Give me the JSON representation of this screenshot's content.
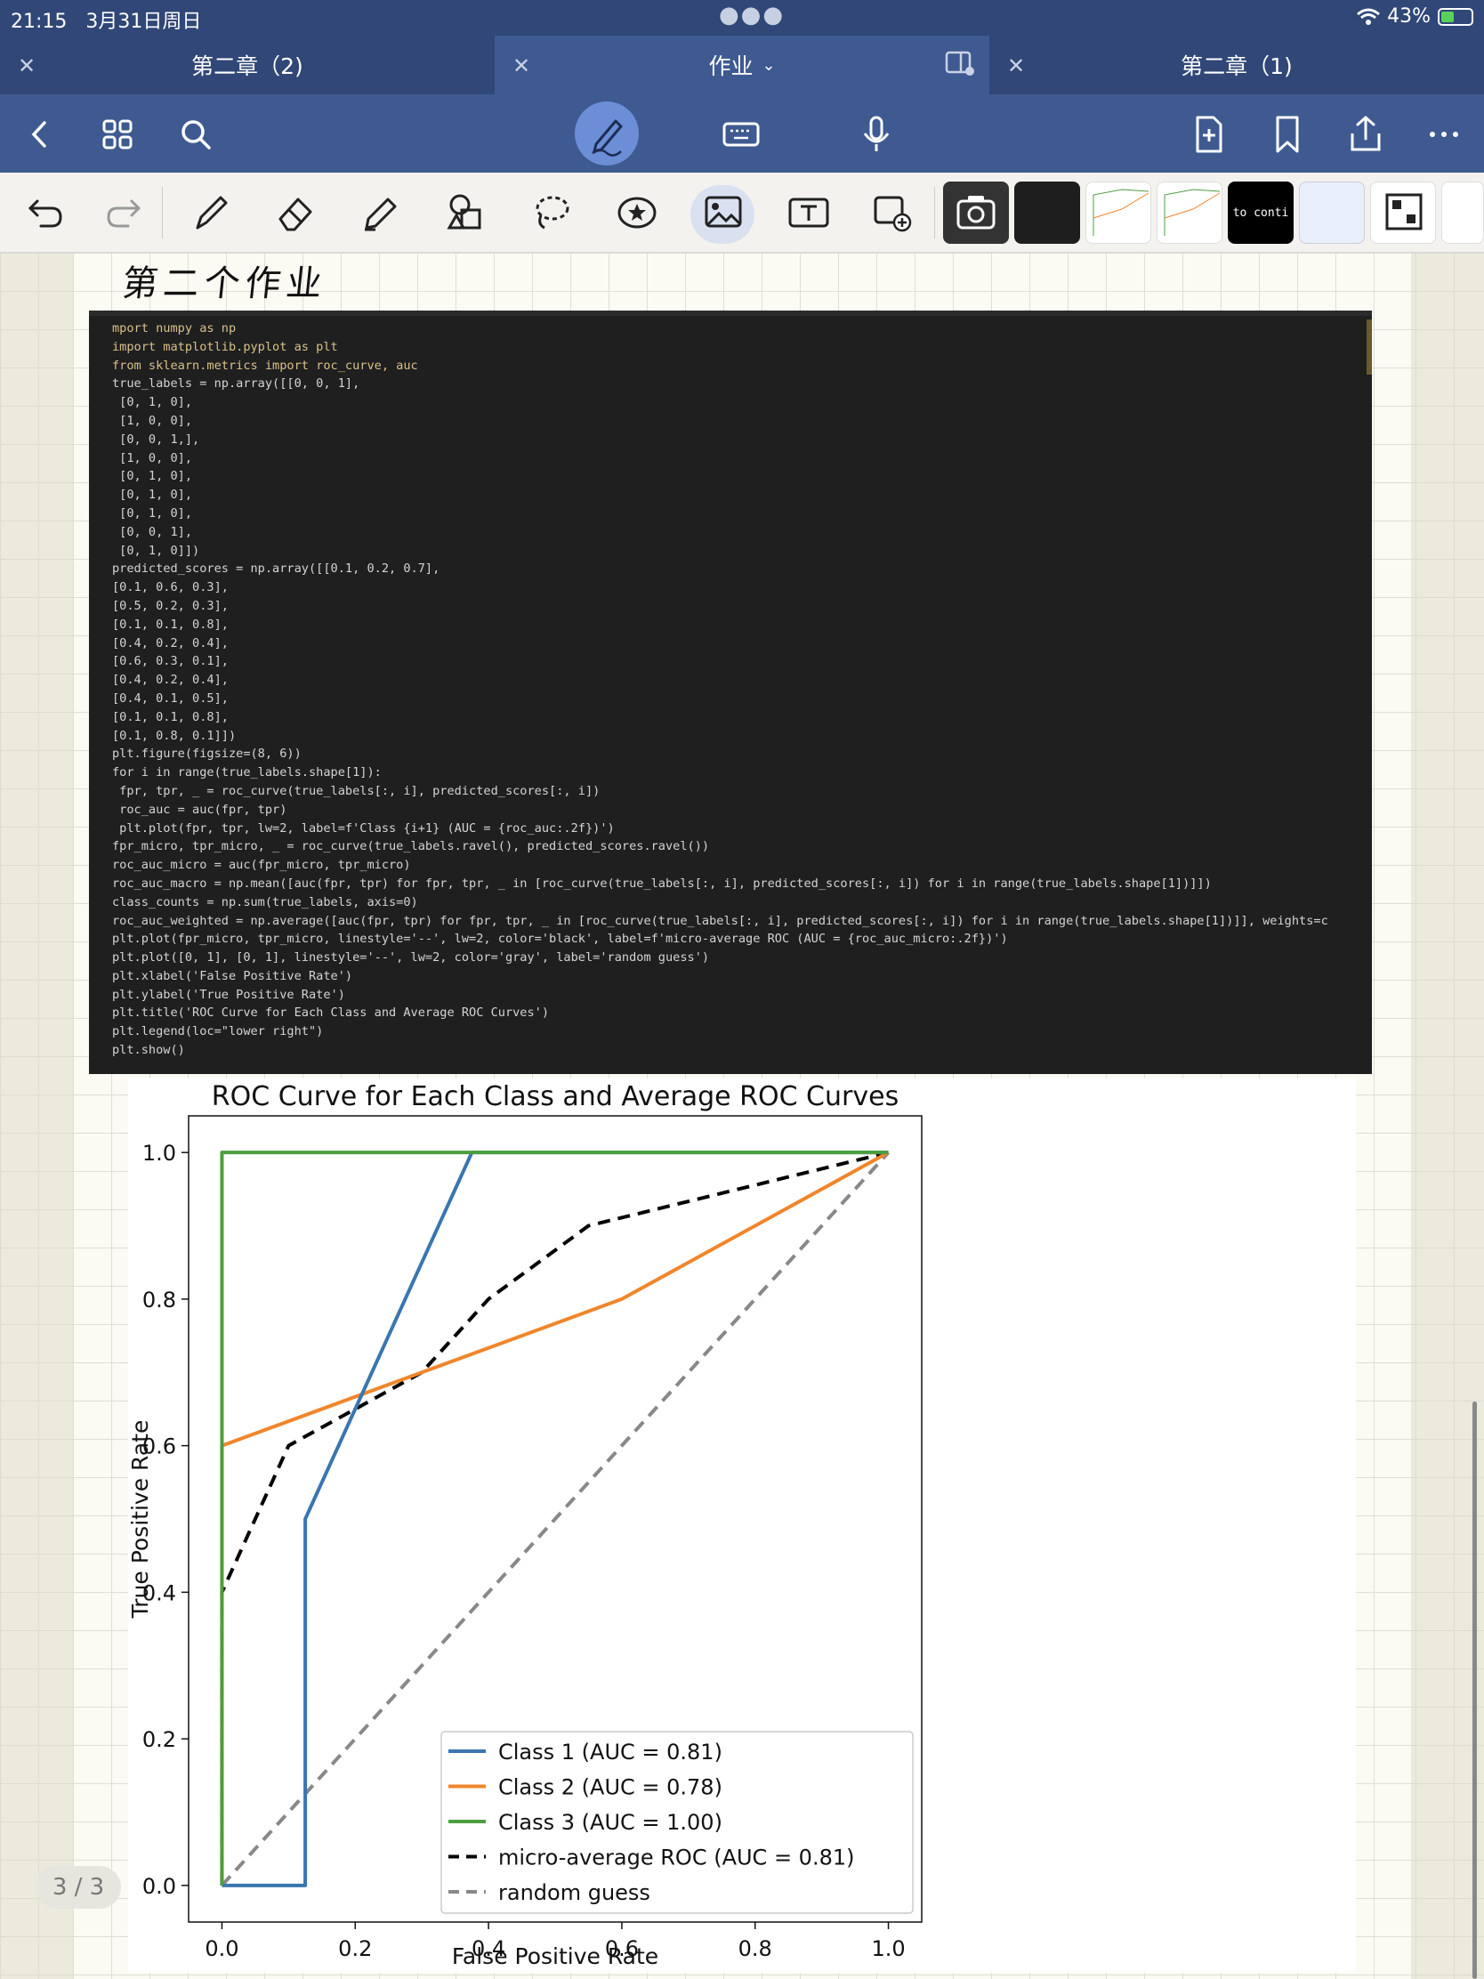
{
  "status": {
    "time": "21:15",
    "date": "3月31日周日",
    "battery": "43%",
    "battery_level": 0.43
  },
  "tabs": [
    {
      "label": "第二章（2)",
      "active": false
    },
    {
      "label": "作业",
      "active": true
    },
    {
      "label": "第二章（1)",
      "active": false
    }
  ],
  "tab_icons": {
    "close": "close-icon",
    "split": "split-view-icon",
    "dropdown": "chevron-down-icon"
  },
  "toolbar": {
    "icons": [
      "back-icon",
      "grid-icon",
      "search-icon",
      "pen-mode-icon",
      "keyboard-icon",
      "microphone-icon",
      "add-page-icon",
      "bookmark-icon",
      "share-icon",
      "more-icon"
    ]
  },
  "tools": {
    "icons": [
      "undo-icon",
      "redo-icon",
      "pen-icon",
      "eraser-icon",
      "highlighter-icon",
      "shapes-icon",
      "lasso-icon",
      "sticker-icon",
      "image-icon",
      "text-box-icon",
      "image-add-icon",
      "camera-icon"
    ],
    "thumb_text": "to conti"
  },
  "note": {
    "title": "第二个作业",
    "page_indicator": "3 / 3"
  },
  "code": [
    "mport numpy as np",
    "import matplotlib.pyplot as plt",
    "from sklearn.metrics import roc_curve, auc",
    "true_labels = np.array([[0, 0, 1],",
    " [0, 1, 0],",
    " [1, 0, 0],",
    " [0, 0, 1,],",
    " [1, 0, 0],",
    " [0, 1, 0],",
    " [0, 1, 0],",
    " [0, 1, 0],",
    " [0, 0, 1],",
    " [0, 1, 0]])",
    "predicted_scores = np.array([[0.1, 0.2, 0.7],",
    "[0.1, 0.6, 0.3],",
    "[0.5, 0.2, 0.3],",
    "[0.1, 0.1, 0.8],",
    "[0.4, 0.2, 0.4],",
    "[0.6, 0.3, 0.1],",
    "[0.4, 0.2, 0.4],",
    "[0.4, 0.1, 0.5],",
    "[0.1, 0.1, 0.8],",
    "[0.1, 0.8, 0.1]])",
    "plt.figure(figsize=(8, 6))",
    "for i in range(true_labels.shape[1]):",
    " fpr, tpr, _ = roc_curve(true_labels[:, i], predicted_scores[:, i])",
    " roc_auc = auc(fpr, tpr)",
    " plt.plot(fpr, tpr, lw=2, label=f'Class {i+1} (AUC = {roc_auc:.2f})')",
    "fpr_micro, tpr_micro, _ = roc_curve(true_labels.ravel(), predicted_scores.ravel())",
    "roc_auc_micro = auc(fpr_micro, tpr_micro)",
    "roc_auc_macro = np.mean([auc(fpr, tpr) for fpr, tpr, _ in [roc_curve(true_labels[:, i], predicted_scores[:, i]) for i in range(true_labels.shape[1])]])",
    "class_counts = np.sum(true_labels, axis=0)",
    "roc_auc_weighted = np.average([auc(fpr, tpr) for fpr, tpr, _ in [roc_curve(true_labels[:, i], predicted_scores[:, i]) for i in range(true_labels.shape[1])]], weights=c",
    "plt.plot(fpr_micro, tpr_micro, linestyle='--', lw=2, color='black', label=f'micro-average ROC (AUC = {roc_auc_micro:.2f})')",
    "plt.plot([0, 1], [0, 1], linestyle='--', lw=2, color='gray', label='random guess')",
    "plt.xlabel('False Positive Rate')",
    "plt.ylabel('True Positive Rate')",
    "plt.title('ROC Curve for Each Class and Average ROC Curves')",
    "plt.legend(loc=\"lower right\")",
    "plt.show()"
  ],
  "chart_data": {
    "type": "line",
    "title": "ROC Curve for Each Class and Average ROC Curves",
    "xlabel": "False Positive Rate",
    "ylabel": "True Positive Rate",
    "xlim": [
      -0.05,
      1.05
    ],
    "ylim": [
      -0.05,
      1.05
    ],
    "xticks": [
      "0.0",
      "0.2",
      "0.4",
      "0.6",
      "0.8",
      "1.0"
    ],
    "yticks": [
      "0.0",
      "0.2",
      "0.4",
      "0.6",
      "0.8",
      "1.0"
    ],
    "xtick_values": [
      0,
      0.2,
      0.4,
      0.6,
      0.8,
      1.0
    ],
    "ytick_values": [
      0,
      0.2,
      0.4,
      0.6,
      0.8,
      1.0
    ],
    "legend_position": "lower right",
    "series": [
      {
        "name": "Class 1 (AUC = 0.81)",
        "color": "#3a75b0",
        "dash": false,
        "x": [
          0,
          0,
          0.125,
          0.125,
          0.375,
          1.0
        ],
        "y": [
          0,
          0,
          0,
          0.5,
          1.0,
          1.0
        ]
      },
      {
        "name": "Class 2 (AUC = 0.78)",
        "color": "#f0862a",
        "dash": false,
        "x": [
          0,
          0,
          0.6,
          1.0
        ],
        "y": [
          0,
          0.6,
          0.8,
          1.0
        ]
      },
      {
        "name": "Class 3 (AUC = 1.00)",
        "color": "#4b9f3e",
        "dash": false,
        "x": [
          0,
          0,
          1.0
        ],
        "y": [
          0,
          1.0,
          1.0
        ]
      },
      {
        "name": "micro-average ROC (AUC = 0.81)",
        "color": "#000000",
        "dash": true,
        "x": [
          0,
          0,
          0.1,
          0.3,
          0.4,
          0.55,
          1.0
        ],
        "y": [
          0,
          0.4,
          0.6,
          0.7,
          0.8,
          0.9,
          1.0
        ]
      },
      {
        "name": "random guess",
        "color": "#888888",
        "dash": true,
        "x": [
          0,
          1.0
        ],
        "y": [
          0,
          1.0
        ]
      }
    ]
  }
}
